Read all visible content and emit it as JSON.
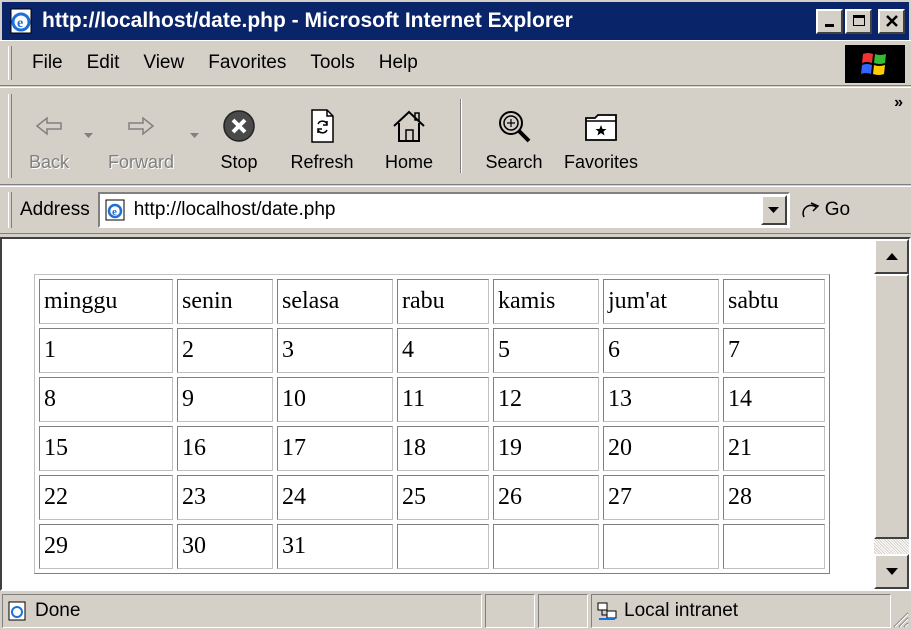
{
  "window": {
    "title": "http://localhost/date.php - Microsoft Internet Explorer",
    "minimize_label": "_",
    "maximize_label": "□",
    "close_label": "×"
  },
  "menu": [
    {
      "label": "File"
    },
    {
      "label": "Edit"
    },
    {
      "label": "View"
    },
    {
      "label": "Favorites"
    },
    {
      "label": "Tools"
    },
    {
      "label": "Help"
    }
  ],
  "toolbar": {
    "back": "Back",
    "forward": "Forward",
    "stop": "Stop",
    "refresh": "Refresh",
    "home": "Home",
    "search": "Search",
    "favorites": "Favorites",
    "more": "»"
  },
  "address": {
    "label": "Address",
    "url": "http://localhost/date.php",
    "go_label": "Go"
  },
  "calendar": {
    "headers": [
      "minggu",
      "senin",
      "selasa",
      "rabu",
      "kamis",
      "jum'at",
      "sabtu"
    ],
    "rows": [
      [
        "1",
        "2",
        "3",
        "4",
        "5",
        "6",
        "7"
      ],
      [
        "8",
        "9",
        "10",
        "11",
        "12",
        "13",
        "14"
      ],
      [
        "15",
        "16",
        "17",
        "18",
        "19",
        "20",
        "21"
      ],
      [
        "22",
        "23",
        "24",
        "25",
        "26",
        "27",
        "28"
      ],
      [
        "29",
        "30",
        "31",
        "",
        "",
        "",
        ""
      ]
    ]
  },
  "status": {
    "text": "Done",
    "zone": "Local intranet"
  },
  "colors": {
    "titlebar": "#0a246a",
    "chrome": "#d4d0c8"
  },
  "icons": {
    "app": "ie-page-icon",
    "back": "back-arrow-icon",
    "forward": "forward-arrow-icon",
    "stop": "stop-icon",
    "refresh": "refresh-icon",
    "home": "home-icon",
    "search": "search-icon",
    "favorites": "favorites-icon",
    "go": "go-arrow-icon",
    "zone": "local-intranet-icon"
  }
}
